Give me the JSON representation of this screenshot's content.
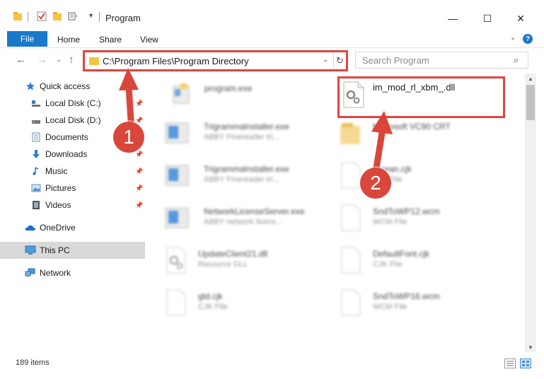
{
  "window": {
    "title": "Program",
    "minimize": "—",
    "maximize": "☐",
    "close": "✕"
  },
  "ribbon": {
    "file": "File",
    "tabs": [
      "Home",
      "Share",
      "View"
    ],
    "help": "?"
  },
  "address": {
    "path": "C:\\Program Files\\Program Directory",
    "search_placeholder": "Search Program"
  },
  "sidebar": {
    "items": [
      {
        "label": "Quick access",
        "icon": "star-icon"
      },
      {
        "label": "Local Disk (C:)",
        "icon": "drive-icon",
        "pinned": true
      },
      {
        "label": "Local Disk (D:)",
        "icon": "drive-icon",
        "pinned": true
      },
      {
        "label": "Documents",
        "icon": "documents-icon",
        "pinned": true
      },
      {
        "label": "Downloads",
        "icon": "downloads-icon",
        "pinned": true
      },
      {
        "label": "Music",
        "icon": "music-icon",
        "pinned": true
      },
      {
        "label": "Pictures",
        "icon": "pictures-icon",
        "pinned": true
      },
      {
        "label": "Videos",
        "icon": "videos-icon",
        "pinned": true
      },
      {
        "label": "OneDrive",
        "icon": "cloud-icon"
      },
      {
        "label": "This PC",
        "icon": "computer-icon",
        "selected": true
      },
      {
        "label": "Network",
        "icon": "network-icon"
      }
    ]
  },
  "files": [
    {
      "name": "program.exe",
      "type": "",
      "col": 0,
      "row": 0,
      "icon": "exe-icon"
    },
    {
      "name": "im_mod_rl_xbm_.dll",
      "type": "",
      "col": 1,
      "row": 0,
      "icon": "dll-icon",
      "highlighted": true
    },
    {
      "name": "Trigrammalnstaller.exe",
      "type": "ABBY Finereader tri...",
      "col": 0,
      "row": 1,
      "icon": "installer-icon"
    },
    {
      "name": "Microsoft VC90 CRT",
      "type": "",
      "col": 1,
      "row": 1,
      "icon": "folder-icon"
    },
    {
      "name": "Trigrammalnstaller.exe",
      "type": "ABBY Finereader tri...",
      "col": 0,
      "row": 2,
      "icon": "installer-icon"
    },
    {
      "name": "korean.cjk",
      "type": "CJK File",
      "col": 1,
      "row": 2,
      "icon": "file-icon"
    },
    {
      "name": "NetworkLicenseServer.exe",
      "type": "ABBY network licens...",
      "col": 0,
      "row": 3,
      "icon": "installer-icon"
    },
    {
      "name": "SndToWP12.wcm",
      "type": "WCM File",
      "col": 1,
      "row": 3,
      "icon": "file-icon"
    },
    {
      "name": "UpdateClient21.dll",
      "type": "Resource DLL",
      "col": 0,
      "row": 4,
      "icon": "dll-icon"
    },
    {
      "name": "DefaultFont.cjk",
      "type": "CJK File",
      "col": 1,
      "row": 4,
      "icon": "file-icon"
    },
    {
      "name": "gtd.cjk",
      "type": "CJK File",
      "col": 0,
      "row": 5,
      "icon": "file-icon"
    },
    {
      "name": "SndToWP16.wcm",
      "type": "WCM File",
      "col": 1,
      "row": 5,
      "icon": "file-icon"
    }
  ],
  "status": {
    "count": "189 items"
  },
  "annotations": {
    "step1": "1",
    "step2": "2"
  },
  "colors": {
    "accent": "#1979ca",
    "highlight_border": "#e0453f",
    "badge": "#d9463b",
    "selected_bg": "#d9d9d9"
  }
}
